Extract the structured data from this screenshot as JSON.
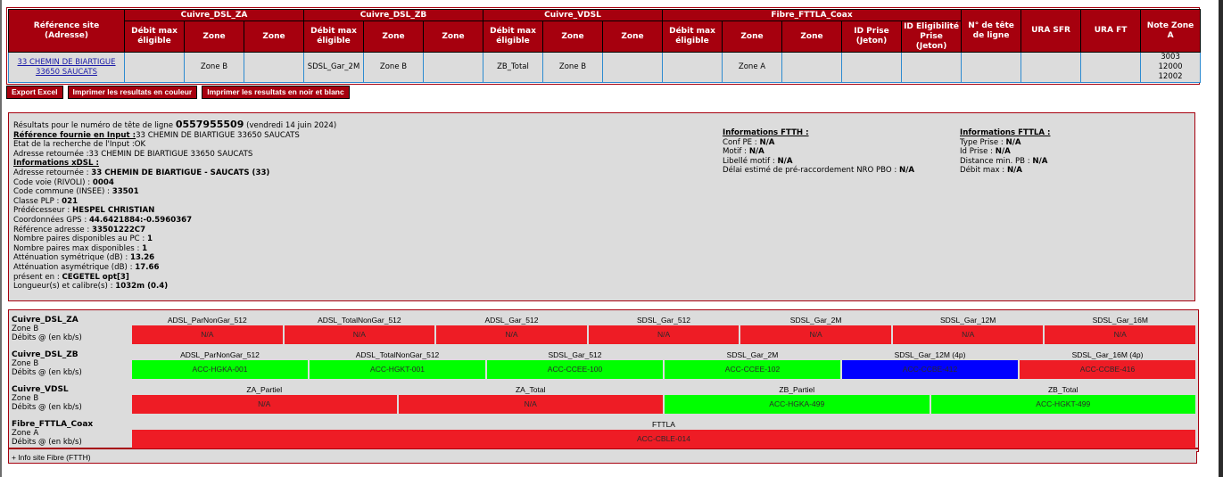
{
  "top_table": {
    "ref_header": "Référence site (Adresse)",
    "groups": [
      {
        "name": "Cuivre_DSL_ZA",
        "cols": [
          "Débit max éligible",
          "Zone",
          "Zone"
        ]
      },
      {
        "name": "Cuivre_DSL_ZB",
        "cols": [
          "Débit max éligible",
          "Zone",
          "Zone"
        ]
      },
      {
        "name": "Cuivre_VDSL",
        "cols": [
          "Débit max éligible",
          "Zone",
          "Zone"
        ]
      },
      {
        "name": "Fibre_FTTLA_Coax",
        "cols": [
          "Débit max éligible",
          "Zone",
          "Zone",
          "ID Prise (Jeton)",
          "ID Eligibilité Prise (Jeton)"
        ]
      }
    ],
    "extra_headers": [
      "N° de tête de ligne",
      "URA SFR",
      "URA FT",
      "Note Zone A"
    ],
    "row": {
      "address_line1": "33 CHEMIN DE BIARTIGUE",
      "address_line2": "33650 SAUCATS",
      "cells": [
        "",
        "Zone B",
        "",
        "SDSL_Gar_2M",
        "Zone B",
        "",
        "ZB_Total",
        "Zone B",
        "",
        "",
        "Zone A",
        "",
        "",
        "",
        "",
        "",
        ""
      ],
      "note_zone_a": [
        "3003",
        "12000",
        "12002"
      ]
    }
  },
  "buttons": {
    "export_excel": "Export Excel",
    "print_color": "Imprimer les resultats en couleur",
    "print_bw": "Imprimer les resultats en noir et blanc"
  },
  "info": {
    "results_prefix": "Résultats pour le numéro de tête de ligne",
    "line_number": "0557955509",
    "date": "(vendredi 14 juin 2024)",
    "input_ref_label": "Référence fournie en Input :",
    "input_ref_value": "33 CHEMIN DE BIARTIGUE 33650 SAUCATS",
    "search_state": "Etat de la recherche de l'Input :OK",
    "returned_address": "Adresse retournée :33 CHEMIN DE BIARTIGUE 33650 SAUCATS",
    "xdsl_header": "Informations xDSL :",
    "xdsl": [
      {
        "label": "Adresse retournée : ",
        "value": "33 CHEMIN DE BIARTIGUE - SAUCATS (33)"
      },
      {
        "label": "Code voie (RIVOLI) : ",
        "value": "0004"
      },
      {
        "label": "Code commune (INSEE) : ",
        "value": "33501"
      },
      {
        "label": "Classe PLP : ",
        "value": "021"
      },
      {
        "label": "Prédécesseur : ",
        "value": "HESPEL CHRISTIAN"
      },
      {
        "label": "Coordonnées GPS : ",
        "value": "44.6421884:-0.5960367"
      },
      {
        "label": "Référence adresse : ",
        "value": "33501222C7"
      },
      {
        "label": "Nombre paires disponibles au PC : ",
        "value": "1"
      },
      {
        "label": "Nombre paires max disponibles : ",
        "value": "1"
      },
      {
        "label": "Atténuation symétrique (dB) : ",
        "value": "13.26"
      },
      {
        "label": "Atténuation asymétrique (dB) : ",
        "value": "17.66"
      },
      {
        "label": "présent en : ",
        "value": "CEGETEL opt[3]"
      },
      {
        "label": "Longueur(s) et calibre(s) : ",
        "value": "1032m (0.4)"
      }
    ],
    "ftth_header": "Informations FTTH :",
    "ftth": [
      {
        "label": "Conf PE : ",
        "value": "N/A"
      },
      {
        "label": "Motif : ",
        "value": "N/A"
      },
      {
        "label": "Libellé motif : ",
        "value": "N/A"
      },
      {
        "label": "Délai estimé de pré-raccordement NRO PBO : ",
        "value": "N/A"
      }
    ],
    "fttla_header": "Informations FTTLA :",
    "fttla": [
      {
        "label": "Type Prise : ",
        "value": "N/A"
      },
      {
        "label": "Id Prise : ",
        "value": "N/A"
      },
      {
        "label": "Distance min. PB : ",
        "value": "N/A"
      },
      {
        "label": "Débit max : ",
        "value": "N/A"
      }
    ]
  },
  "debits": [
    {
      "name": "Cuivre_DSL_ZA",
      "zone": "Zone B",
      "unit": "Débits @ (en kb/s)",
      "cells": [
        {
          "title": "ADSL_ParNonGar_512",
          "value": "N/A",
          "status": "red"
        },
        {
          "title": "ADSL_TotalNonGar_512",
          "value": "N/A",
          "status": "red"
        },
        {
          "title": "ADSL_Gar_512",
          "value": "N/A",
          "status": "red"
        },
        {
          "title": "SDSL_Gar_512",
          "value": "N/A",
          "status": "red"
        },
        {
          "title": "SDSL_Gar_2M",
          "value": "N/A",
          "status": "red"
        },
        {
          "title": "SDSL_Gar_12M",
          "value": "N/A",
          "status": "red"
        },
        {
          "title": "SDSL_Gar_16M",
          "value": "N/A",
          "status": "red"
        }
      ]
    },
    {
      "name": "Cuivre_DSL_ZB",
      "zone": "Zone B",
      "unit": "Débits @ (en kb/s)",
      "cells": [
        {
          "title": "ADSL_ParNonGar_512",
          "value": "ACC-HGKA-001",
          "status": "green"
        },
        {
          "title": "ADSL_TotalNonGar_512",
          "value": "ACC-HGKT-001",
          "status": "green"
        },
        {
          "title": "SDSL_Gar_512",
          "value": "ACC-CCEE-100",
          "status": "green"
        },
        {
          "title": "SDSL_Gar_2M",
          "value": "ACC-CCEE-102",
          "status": "green"
        },
        {
          "title": "SDSL_Gar_12M (4p)",
          "value": "ACC-CCBE-412",
          "status": "blue"
        },
        {
          "title": "SDSL_Gar_16M (4p)",
          "value": "ACC-CCBE-416",
          "status": "red"
        }
      ]
    },
    {
      "name": "Cuivre_VDSL",
      "zone": "Zone B",
      "unit": "Débits @ (en kb/s)",
      "cells": [
        {
          "title": "ZA_Partiel",
          "value": "N/A",
          "status": "red"
        },
        {
          "title": "ZA_Total",
          "value": "N/A",
          "status": "red"
        },
        {
          "title": "ZB_Partiel",
          "value": "ACC-HGKA-499",
          "status": "green"
        },
        {
          "title": "ZB_Total",
          "value": "ACC-HGKT-499",
          "status": "green"
        }
      ]
    },
    {
      "name": "Fibre_FTTLA_Coax",
      "zone": "Zone A",
      "unit": "Débits @ (en kb/s)",
      "cells": [
        {
          "title": "FTTLA",
          "value": "ACC-CBLE-014",
          "status": "red"
        }
      ]
    }
  ],
  "ftth_toggle": "+ Info site Fibre (FTTH)",
  "colors": {
    "header_red": "#a6000e",
    "status_red": "#ee1c25",
    "status_green": "#00ff00",
    "status_blue": "#0000ff",
    "panel_gray": "#dcdcdc"
  }
}
